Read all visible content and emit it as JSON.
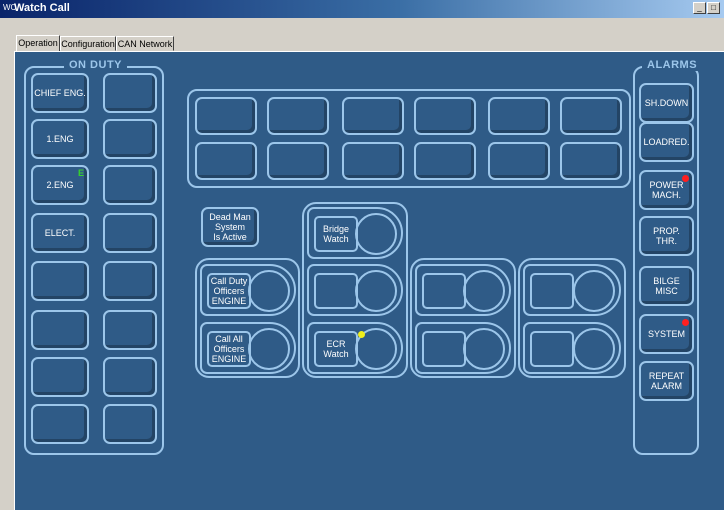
{
  "window": {
    "app_icon": "WC",
    "title": "Watch Call"
  },
  "tabs": [
    {
      "label": "Operation",
      "active": true
    },
    {
      "label": "Configuration",
      "active": false
    },
    {
      "label": "CAN Network",
      "active": false
    }
  ],
  "on_duty": {
    "title": "ON DUTY",
    "left_buttons": [
      "CHIEF ENG.",
      "1.ENG",
      "2.ENG",
      "ELECT.",
      "",
      "",
      "",
      ""
    ],
    "right_buttons": [
      "",
      "",
      "",
      "",
      "",
      "",
      "",
      ""
    ],
    "indicator": {
      "button": "2.ENG",
      "label": "E",
      "color": "#37d32b"
    }
  },
  "center": {
    "dead_man": "Dead Man\nSystem\nIs Active",
    "call_duty": "Call Duty\nOfficers\nENGINE",
    "call_all": "Call All\nOfficers\nENGINE",
    "bridge_watch": "Bridge\nWatch",
    "ecr_watch": "ECR\nWatch",
    "ecr_indicator_color": "#f0ee1a"
  },
  "alarms": {
    "title": "ALARMS",
    "items": [
      "SH.DOWN",
      "LOADRED.",
      "POWER\nMACH.",
      "PROP.\nTHR.",
      "BILGE\nMISC",
      "SYSTEM",
      "REPEAT\nALARM"
    ],
    "active_color": "#ff2020",
    "active_items": [
      "POWER\nMACH.",
      "SYSTEM"
    ]
  },
  "colors": {
    "background": "#2f5b87",
    "outline": "#9cc6ea"
  }
}
